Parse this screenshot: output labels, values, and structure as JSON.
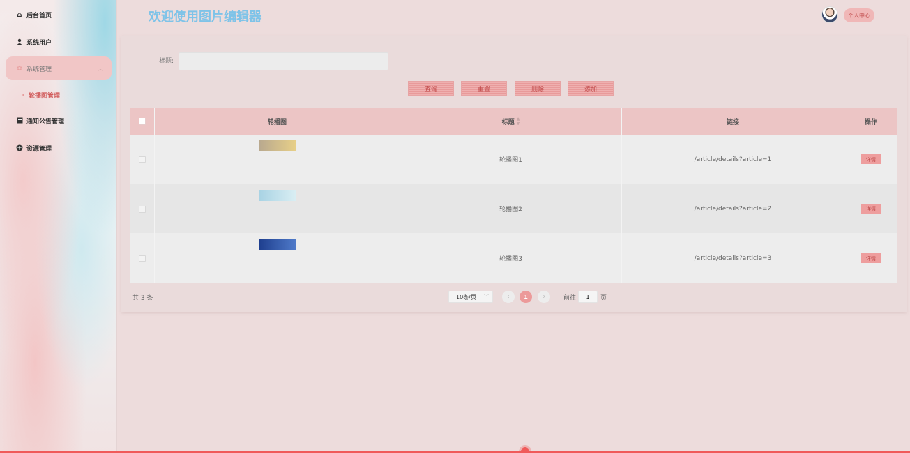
{
  "header": {
    "title": "欢迎使用图片编辑器",
    "profile_label": "个人中心"
  },
  "sidebar": {
    "items": [
      {
        "label": "后台首页",
        "icon": "home-icon"
      },
      {
        "label": "系统用户",
        "icon": "user-icon"
      },
      {
        "label": "系统管理",
        "icon": "settings-icon",
        "expanded": true
      },
      {
        "label": "通知公告管理",
        "icon": "document-icon"
      },
      {
        "label": "资源管理",
        "icon": "plus-circle-icon"
      }
    ],
    "sub_items": [
      {
        "label": "轮播图管理",
        "active": true
      }
    ]
  },
  "search": {
    "label": "标题:",
    "value": "",
    "placeholder": ""
  },
  "actions": {
    "query": "查询",
    "reset": "重置",
    "delete": "删除",
    "add": "添加"
  },
  "table": {
    "columns": [
      "轮播图",
      "标题",
      "链接",
      "操作"
    ],
    "rows": [
      {
        "title": "轮播图1",
        "link": "/article/details?article=1",
        "op": "详情",
        "thumb_colors": [
          "#c9b79a",
          "#e3c97a"
        ]
      },
      {
        "title": "轮播图2",
        "link": "/article/details?article=2",
        "op": "详情",
        "thumb_colors": [
          "#a9d3e4",
          "#d9eef3"
        ]
      },
      {
        "title": "轮播图3",
        "link": "/article/details?article=3",
        "op": "详情",
        "thumb_colors": [
          "#1f3f8f",
          "#4f7ac9"
        ]
      }
    ]
  },
  "pagination": {
    "total_text": "共 3 条",
    "page_size": "10条/页",
    "current_page": "1",
    "goto_prefix": "前往",
    "goto_value": "1",
    "goto_suffix": "页"
  },
  "colors": {
    "accent": "#ec9a9a",
    "title": "#7ec3e8",
    "header_row": "#ecc5c5"
  }
}
